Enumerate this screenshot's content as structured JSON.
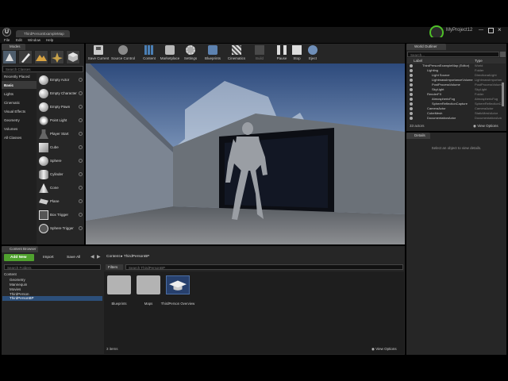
{
  "app": {
    "logo": "U",
    "tab_title": "ThirdPersonExampleMap",
    "project_name": "MyProject12",
    "menu": [
      "File",
      "Edit",
      "Window",
      "Help"
    ]
  },
  "modes": {
    "tab_label": "Modes",
    "mode_icons": [
      "place-mode-icon",
      "paint-mode-icon",
      "landscape-mode-icon",
      "foliage-mode-icon",
      "geometry-mode-icon"
    ],
    "search_placeholder": "Search Classes",
    "categories": [
      "Recently Placed",
      "Basic",
      "Lights",
      "Cinematic",
      "Visual Effects",
      "Geometry",
      "Volumes",
      "All Classes"
    ],
    "selected_category": "Basic",
    "items": [
      "Empty Actor",
      "Empty Character",
      "Empty Pawn",
      "Point Light",
      "Player Start",
      "Cube",
      "Sphere",
      "Cylinder",
      "Cone",
      "Plane",
      "Box Trigger",
      "Sphere Trigger"
    ]
  },
  "toolbar": {
    "buttons": [
      {
        "label": "Save Current",
        "icon": "save-icon"
      },
      {
        "label": "Source Control",
        "icon": "source-control-icon"
      },
      {
        "label": "Content",
        "icon": "content-icon"
      },
      {
        "label": "Marketplace",
        "icon": "marketplace-icon"
      },
      {
        "label": "Settings",
        "icon": "settings-icon"
      },
      {
        "label": "Blueprints",
        "icon": "blueprints-icon"
      },
      {
        "label": "Cinematics",
        "icon": "cinematics-icon"
      },
      {
        "label": "Build",
        "icon": "build-icon"
      },
      {
        "label": "Pause",
        "icon": "pause-icon"
      },
      {
        "label": "Stop",
        "icon": "stop-icon"
      },
      {
        "label": "Eject",
        "icon": "eject-icon"
      }
    ]
  },
  "outliner": {
    "tab_label": "World Outliner",
    "search_placeholder": "Search...",
    "col_label": "Label",
    "col_type": "Type",
    "rows": [
      {
        "label": "ThirdPersonExampleMap (Editor)",
        "type": "World"
      },
      {
        "label": "Lighting",
        "type": "Folder"
      },
      {
        "label": "Light Source",
        "type": "DirectionalLight"
      },
      {
        "label": "LightmassImportanceVolume",
        "type": "LightmassImportanceVolume"
      },
      {
        "label": "PostProcessVolume",
        "type": "PostProcessVolume"
      },
      {
        "label": "SkyLight",
        "type": "SkyLight"
      },
      {
        "label": "RenderFX",
        "type": "Folder"
      },
      {
        "label": "AtmosphericFog",
        "type": "AtmosphericFog"
      },
      {
        "label": "SphereReflectionCapture",
        "type": "SphereReflectionCapture"
      },
      {
        "label": "CameraActor",
        "type": "CameraActor"
      },
      {
        "label": "CubeMesh",
        "type": "StaticMeshActor"
      },
      {
        "label": "DocumentationActor",
        "type": "DocumentationActor"
      }
    ],
    "actor_count": "33 actors",
    "view_options": "View Options"
  },
  "details": {
    "tab_label": "Details",
    "empty_message": "Select an object to view details."
  },
  "content_browser": {
    "tab_label": "Content Browser",
    "add_new": "Add New",
    "import": "Import",
    "save_all": "Save All",
    "path_root": "Content",
    "path_current": "ThirdPersonBP",
    "filter_search_placeholder": "Search Folders",
    "filters_label": "Filters",
    "asset_search_placeholder": "Search ThirdPersonBP",
    "tree": [
      "Content",
      "Geometry",
      "Mannequin",
      "Movies",
      "ThirdPerson",
      "ThirdPersonBP"
    ],
    "assets": [
      {
        "label": "Blueprints",
        "kind": "folder"
      },
      {
        "label": "Maps",
        "kind": "folder"
      },
      {
        "label": "ThirdPerson Overview",
        "kind": "tutorial"
      }
    ],
    "item_count": "3 items",
    "view_options": "View Options"
  },
  "colors": {
    "accent_green": "#4fa12e",
    "panel": "#262626",
    "selection": "#2c4f7a"
  }
}
